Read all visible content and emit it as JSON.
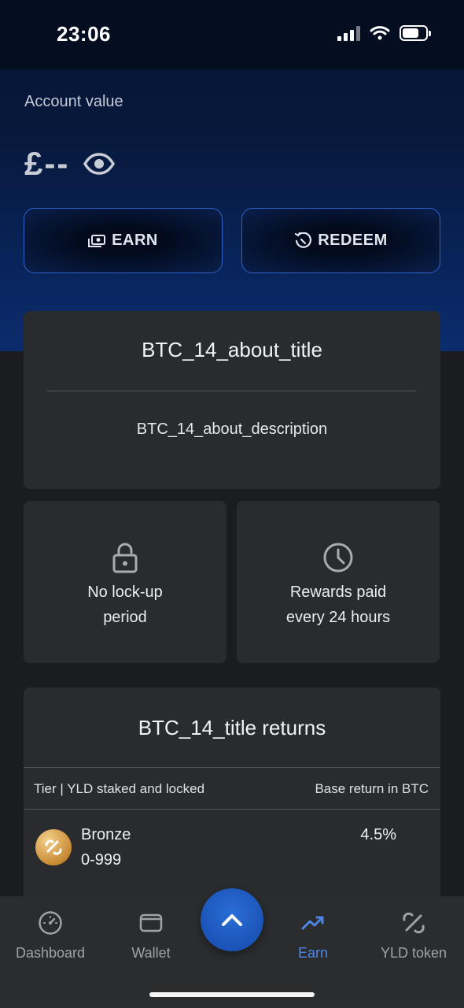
{
  "status_bar": {
    "time": "23:06"
  },
  "account": {
    "label": "Account value",
    "balance": "£--"
  },
  "actions": {
    "earn_label": "EARN",
    "redeem_label": "REDEEM"
  },
  "about": {
    "title": "BTC_14_about_title",
    "description": "BTC_14_about_description"
  },
  "features": {
    "lockup_line1": "No lock-up",
    "lockup_line2": "period",
    "rewards_line1": "Rewards paid",
    "rewards_line2": "every 24 hours"
  },
  "returns": {
    "title": "BTC_14_title returns",
    "col_tier": "Tier | YLD staked and locked",
    "col_return": "Base return in BTC",
    "rows": [
      {
        "name": "Bronze",
        "range": "0-999",
        "return": "4.5%"
      }
    ]
  },
  "nav": {
    "dashboard": "Dashboard",
    "wallet": "Wallet",
    "earn": "Earn",
    "yld_token": "YLD token"
  },
  "colors": {
    "accent": "#4f86e6",
    "card": "#2a2b2e",
    "background": "#1b1c1f"
  },
  "icons": [
    "eye-icon",
    "earn-cash-icon",
    "redeem-icon",
    "lock-icon",
    "clock-icon",
    "bronze-badge-icon",
    "dashboard-gauge-icon",
    "wallet-icon",
    "chevron-up-icon",
    "trending-up-icon",
    "yld-token-icon"
  ]
}
